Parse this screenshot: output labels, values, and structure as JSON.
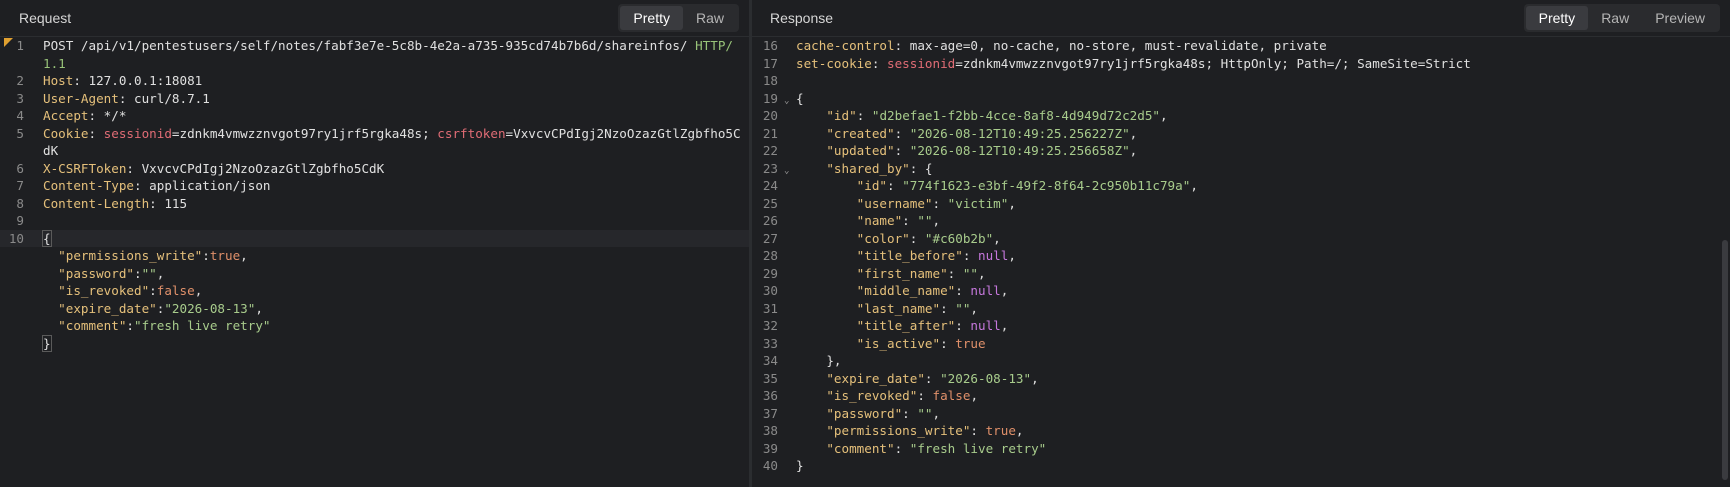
{
  "request": {
    "title": "Request",
    "tabs": [
      "Pretty",
      "Raw"
    ],
    "active_tab": "Pretty",
    "lines": [
      {
        "n": "1",
        "parts": [
          {
            "t": "POST ",
            "c": "k-method"
          },
          {
            "t": "/api/v1/pentestusers/self/notes/fabf3e7e-5c8b-4e2a-a735-935cd74b7b6d/shareinfos/ ",
            "c": "k-plain"
          },
          {
            "t": "HTTP/",
            "c": "k-ver"
          }
        ]
      },
      {
        "n": "",
        "parts": [
          {
            "t": "1.1",
            "c": "k-ver"
          }
        ]
      },
      {
        "n": "2",
        "parts": [
          {
            "t": "Host",
            "c": "k-header"
          },
          {
            "t": ": 127.0.0.1:18081",
            "c": "k-plain"
          }
        ]
      },
      {
        "n": "3",
        "parts": [
          {
            "t": "User-Agent",
            "c": "k-header"
          },
          {
            "t": ": curl/8.7.1",
            "c": "k-plain"
          }
        ]
      },
      {
        "n": "4",
        "parts": [
          {
            "t": "Accept",
            "c": "k-header"
          },
          {
            "t": ": */*",
            "c": "k-plain"
          }
        ]
      },
      {
        "n": "5",
        "parts": [
          {
            "t": "Cookie",
            "c": "k-header"
          },
          {
            "t": ": ",
            "c": "k-plain"
          },
          {
            "t": "sessionid",
            "c": "k-cookie"
          },
          {
            "t": "=zdnkm4vmwzznvgot97ry1jrf5rgka48s; ",
            "c": "k-plain"
          },
          {
            "t": "csrftoken",
            "c": "k-cookie"
          },
          {
            "t": "=VxvcvCPdIgj2NzoOzazGtlZgbfho5C",
            "c": "k-plain"
          }
        ]
      },
      {
        "n": "",
        "parts": [
          {
            "t": "dK",
            "c": "k-plain"
          }
        ]
      },
      {
        "n": "6",
        "parts": [
          {
            "t": "X-CSRFToken",
            "c": "k-header"
          },
          {
            "t": ": VxvcvCPdIgj2NzoOzazGtlZgbfho5CdK",
            "c": "k-plain"
          }
        ]
      },
      {
        "n": "7",
        "parts": [
          {
            "t": "Content-Type",
            "c": "k-header"
          },
          {
            "t": ": application/json",
            "c": "k-plain"
          }
        ]
      },
      {
        "n": "8",
        "parts": [
          {
            "t": "Content-Length",
            "c": "k-header"
          },
          {
            "t": ": 115",
            "c": "k-plain"
          }
        ]
      },
      {
        "n": "9",
        "parts": []
      },
      {
        "n": "10",
        "cur": true,
        "parts": [
          {
            "t": "{",
            "c": "k-plain",
            "box": true
          }
        ]
      },
      {
        "n": "",
        "parts": [
          {
            "t": "  ",
            "c": "k-plain"
          },
          {
            "t": "\"permissions_write\"",
            "c": "k-jkey"
          },
          {
            "t": ":",
            "c": "k-plain"
          },
          {
            "t": "true",
            "c": "k-bool"
          },
          {
            "t": ",",
            "c": "k-plain"
          }
        ]
      },
      {
        "n": "",
        "parts": [
          {
            "t": "  ",
            "c": "k-plain"
          },
          {
            "t": "\"password\"",
            "c": "k-jkey"
          },
          {
            "t": ":",
            "c": "k-plain"
          },
          {
            "t": "\"\"",
            "c": "k-jstr"
          },
          {
            "t": ",",
            "c": "k-plain"
          }
        ]
      },
      {
        "n": "",
        "parts": [
          {
            "t": "  ",
            "c": "k-plain"
          },
          {
            "t": "\"is_revoked\"",
            "c": "k-jkey"
          },
          {
            "t": ":",
            "c": "k-plain"
          },
          {
            "t": "false",
            "c": "k-bool"
          },
          {
            "t": ",",
            "c": "k-plain"
          }
        ]
      },
      {
        "n": "",
        "parts": [
          {
            "t": "  ",
            "c": "k-plain"
          },
          {
            "t": "\"expire_date\"",
            "c": "k-jkey"
          },
          {
            "t": ":",
            "c": "k-plain"
          },
          {
            "t": "\"2026-08-13\"",
            "c": "k-jstr"
          },
          {
            "t": ",",
            "c": "k-plain"
          }
        ]
      },
      {
        "n": "",
        "parts": [
          {
            "t": "  ",
            "c": "k-plain"
          },
          {
            "t": "\"comment\"",
            "c": "k-jkey"
          },
          {
            "t": ":",
            "c": "k-plain"
          },
          {
            "t": "\"fresh live retry\"",
            "c": "k-jstr"
          }
        ]
      },
      {
        "n": "",
        "parts": [
          {
            "t": "}",
            "c": "k-plain",
            "box": true
          }
        ]
      }
    ]
  },
  "response": {
    "title": "Response",
    "tabs": [
      "Pretty",
      "Raw",
      "Preview"
    ],
    "active_tab": "Pretty",
    "lines": [
      {
        "n": "16",
        "parts": [
          {
            "t": "cache-control",
            "c": "k-header"
          },
          {
            "t": ": max-age=0, no-cache, no-store, must-revalidate, private",
            "c": "k-plain"
          }
        ]
      },
      {
        "n": "17",
        "parts": [
          {
            "t": "set-cookie",
            "c": "k-header"
          },
          {
            "t": ": ",
            "c": "k-plain"
          },
          {
            "t": "sessionid",
            "c": "k-cookie"
          },
          {
            "t": "=zdnkm4vmwzznvgot97ry1jrf5rgka48s; HttpOnly; Path=/; SameSite=Strict",
            "c": "k-plain"
          }
        ]
      },
      {
        "n": "18",
        "parts": []
      },
      {
        "n": "19",
        "fold": true,
        "parts": [
          {
            "t": "{",
            "c": "k-plain"
          }
        ]
      },
      {
        "n": "20",
        "parts": [
          {
            "t": "    ",
            "c": "k-plain"
          },
          {
            "t": "\"id\"",
            "c": "k-jkey"
          },
          {
            "t": ": ",
            "c": "k-plain"
          },
          {
            "t": "\"d2befae1-f2bb-4cce-8af8-4d949d72c2d5\"",
            "c": "k-jstr"
          },
          {
            "t": ",",
            "c": "k-plain"
          }
        ]
      },
      {
        "n": "21",
        "parts": [
          {
            "t": "    ",
            "c": "k-plain"
          },
          {
            "t": "\"created\"",
            "c": "k-jkey"
          },
          {
            "t": ": ",
            "c": "k-plain"
          },
          {
            "t": "\"2026-08-12T10:49:25.256227Z\"",
            "c": "k-jstr"
          },
          {
            "t": ",",
            "c": "k-plain"
          }
        ]
      },
      {
        "n": "22",
        "parts": [
          {
            "t": "    ",
            "c": "k-plain"
          },
          {
            "t": "\"updated\"",
            "c": "k-jkey"
          },
          {
            "t": ": ",
            "c": "k-plain"
          },
          {
            "t": "\"2026-08-12T10:49:25.256658Z\"",
            "c": "k-jstr"
          },
          {
            "t": ",",
            "c": "k-plain"
          }
        ]
      },
      {
        "n": "23",
        "fold": true,
        "parts": [
          {
            "t": "    ",
            "c": "k-plain"
          },
          {
            "t": "\"shared_by\"",
            "c": "k-jkey"
          },
          {
            "t": ": {",
            "c": "k-plain"
          }
        ]
      },
      {
        "n": "24",
        "parts": [
          {
            "t": "        ",
            "c": "k-plain"
          },
          {
            "t": "\"id\"",
            "c": "k-jkey"
          },
          {
            "t": ": ",
            "c": "k-plain"
          },
          {
            "t": "\"774f1623-e3bf-49f2-8f64-2c950b11c79a\"",
            "c": "k-jstr"
          },
          {
            "t": ",",
            "c": "k-plain"
          }
        ]
      },
      {
        "n": "25",
        "parts": [
          {
            "t": "        ",
            "c": "k-plain"
          },
          {
            "t": "\"username\"",
            "c": "k-jkey"
          },
          {
            "t": ": ",
            "c": "k-plain"
          },
          {
            "t": "\"victim\"",
            "c": "k-jstr"
          },
          {
            "t": ",",
            "c": "k-plain"
          }
        ]
      },
      {
        "n": "26",
        "parts": [
          {
            "t": "        ",
            "c": "k-plain"
          },
          {
            "t": "\"name\"",
            "c": "k-jkey"
          },
          {
            "t": ": ",
            "c": "k-plain"
          },
          {
            "t": "\"\"",
            "c": "k-jstr"
          },
          {
            "t": ",",
            "c": "k-plain"
          }
        ]
      },
      {
        "n": "27",
        "parts": [
          {
            "t": "        ",
            "c": "k-plain"
          },
          {
            "t": "\"color\"",
            "c": "k-jkey"
          },
          {
            "t": ": ",
            "c": "k-plain"
          },
          {
            "t": "\"#c60b2b\"",
            "c": "k-jstr"
          },
          {
            "t": ",",
            "c": "k-plain"
          }
        ]
      },
      {
        "n": "28",
        "parts": [
          {
            "t": "        ",
            "c": "k-plain"
          },
          {
            "t": "\"title_before\"",
            "c": "k-jkey"
          },
          {
            "t": ": ",
            "c": "k-plain"
          },
          {
            "t": "null",
            "c": "k-null"
          },
          {
            "t": ",",
            "c": "k-plain"
          }
        ]
      },
      {
        "n": "29",
        "parts": [
          {
            "t": "        ",
            "c": "k-plain"
          },
          {
            "t": "\"first_name\"",
            "c": "k-jkey"
          },
          {
            "t": ": ",
            "c": "k-plain"
          },
          {
            "t": "\"\"",
            "c": "k-jstr"
          },
          {
            "t": ",",
            "c": "k-plain"
          }
        ]
      },
      {
        "n": "30",
        "parts": [
          {
            "t": "        ",
            "c": "k-plain"
          },
          {
            "t": "\"middle_name\"",
            "c": "k-jkey"
          },
          {
            "t": ": ",
            "c": "k-plain"
          },
          {
            "t": "null",
            "c": "k-null"
          },
          {
            "t": ",",
            "c": "k-plain"
          }
        ]
      },
      {
        "n": "31",
        "parts": [
          {
            "t": "        ",
            "c": "k-plain"
          },
          {
            "t": "\"last_name\"",
            "c": "k-jkey"
          },
          {
            "t": ": ",
            "c": "k-plain"
          },
          {
            "t": "\"\"",
            "c": "k-jstr"
          },
          {
            "t": ",",
            "c": "k-plain"
          }
        ]
      },
      {
        "n": "32",
        "parts": [
          {
            "t": "        ",
            "c": "k-plain"
          },
          {
            "t": "\"title_after\"",
            "c": "k-jkey"
          },
          {
            "t": ": ",
            "c": "k-plain"
          },
          {
            "t": "null",
            "c": "k-null"
          },
          {
            "t": ",",
            "c": "k-plain"
          }
        ]
      },
      {
        "n": "33",
        "parts": [
          {
            "t": "        ",
            "c": "k-plain"
          },
          {
            "t": "\"is_active\"",
            "c": "k-jkey"
          },
          {
            "t": ": ",
            "c": "k-plain"
          },
          {
            "t": "true",
            "c": "k-bool"
          }
        ]
      },
      {
        "n": "34",
        "parts": [
          {
            "t": "    },",
            "c": "k-plain"
          }
        ]
      },
      {
        "n": "35",
        "parts": [
          {
            "t": "    ",
            "c": "k-plain"
          },
          {
            "t": "\"expire_date\"",
            "c": "k-jkey"
          },
          {
            "t": ": ",
            "c": "k-plain"
          },
          {
            "t": "\"2026-08-13\"",
            "c": "k-jstr"
          },
          {
            "t": ",",
            "c": "k-plain"
          }
        ]
      },
      {
        "n": "36",
        "parts": [
          {
            "t": "    ",
            "c": "k-plain"
          },
          {
            "t": "\"is_revoked\"",
            "c": "k-jkey"
          },
          {
            "t": ": ",
            "c": "k-plain"
          },
          {
            "t": "false",
            "c": "k-bool"
          },
          {
            "t": ",",
            "c": "k-plain"
          }
        ]
      },
      {
        "n": "37",
        "parts": [
          {
            "t": "    ",
            "c": "k-plain"
          },
          {
            "t": "\"password\"",
            "c": "k-jkey"
          },
          {
            "t": ": ",
            "c": "k-plain"
          },
          {
            "t": "\"\"",
            "c": "k-jstr"
          },
          {
            "t": ",",
            "c": "k-plain"
          }
        ]
      },
      {
        "n": "38",
        "parts": [
          {
            "t": "    ",
            "c": "k-plain"
          },
          {
            "t": "\"permissions_write\"",
            "c": "k-jkey"
          },
          {
            "t": ": ",
            "c": "k-plain"
          },
          {
            "t": "true",
            "c": "k-bool"
          },
          {
            "t": ",",
            "c": "k-plain"
          }
        ]
      },
      {
        "n": "39",
        "parts": [
          {
            "t": "    ",
            "c": "k-plain"
          },
          {
            "t": "\"comment\"",
            "c": "k-jkey"
          },
          {
            "t": ": ",
            "c": "k-plain"
          },
          {
            "t": "\"fresh live retry\"",
            "c": "k-jstr"
          }
        ]
      },
      {
        "n": "40",
        "parts": [
          {
            "t": "}",
            "c": "k-plain"
          }
        ]
      }
    ]
  }
}
